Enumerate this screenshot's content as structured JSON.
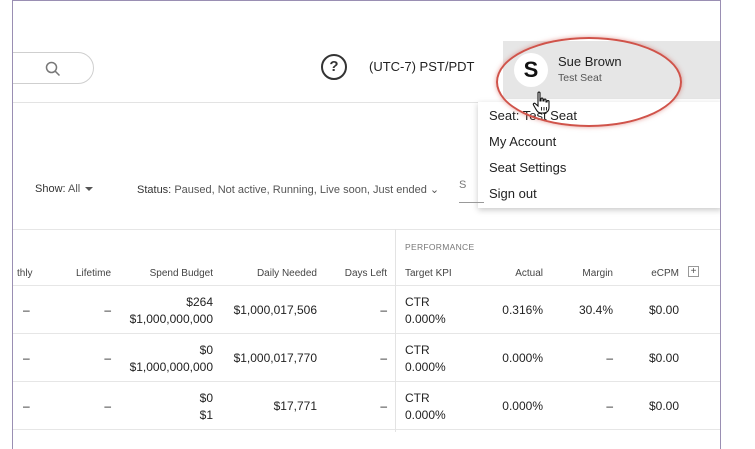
{
  "header": {
    "help_glyph": "?",
    "timezone": "(UTC-7) PST/PDT",
    "user": {
      "avatar_letter": "S",
      "name": "Sue Brown",
      "seat": "Test Seat"
    }
  },
  "user_menu": {
    "items": [
      "Seat: Test Seat",
      "My Account",
      "Seat Settings",
      "Sign out"
    ]
  },
  "filters": {
    "show_label": "Show:",
    "show_value": "All",
    "status_label": "Status:",
    "status_value": "Paused, Not active, Running, Live soon, Just ended",
    "search_partial": "S"
  },
  "table": {
    "group_header": "PERFORMANCE",
    "columns": [
      "thly",
      "Lifetime",
      "Spend Budget",
      "Daily Needed",
      "Days Left",
      "Target KPI",
      "Actual",
      "Margin",
      "eCPM"
    ],
    "add_column": "+",
    "rows": [
      {
        "monthly": "–",
        "lifetime": "–",
        "spend_top": "$264",
        "spend_bottom": "$1,000,000,000",
        "daily_needed": "$1,000,017,506",
        "days_left": "–",
        "kpi_top": "CTR",
        "kpi_bottom": "0.000%",
        "actual": "0.316%",
        "margin": "30.4%",
        "ecpm": "$0.00"
      },
      {
        "monthly": "–",
        "lifetime": "–",
        "spend_top": "$0",
        "spend_bottom": "$1,000,000,000",
        "daily_needed": "$1,000,017,770",
        "days_left": "–",
        "kpi_top": "CTR",
        "kpi_bottom": "0.000%",
        "actual": "0.000%",
        "margin": "–",
        "ecpm": "$0.00"
      },
      {
        "monthly": "–",
        "lifetime": "–",
        "spend_top": "$0",
        "spend_bottom": "$1",
        "daily_needed": "$17,771",
        "days_left": "–",
        "kpi_top": "CTR",
        "kpi_bottom": "0.000%",
        "actual": "0.000%",
        "margin": "–",
        "ecpm": "$0.00"
      }
    ]
  },
  "colors": {
    "highlight_ellipse": "#d0534a",
    "user_card_bg": "#e6e6e6"
  }
}
